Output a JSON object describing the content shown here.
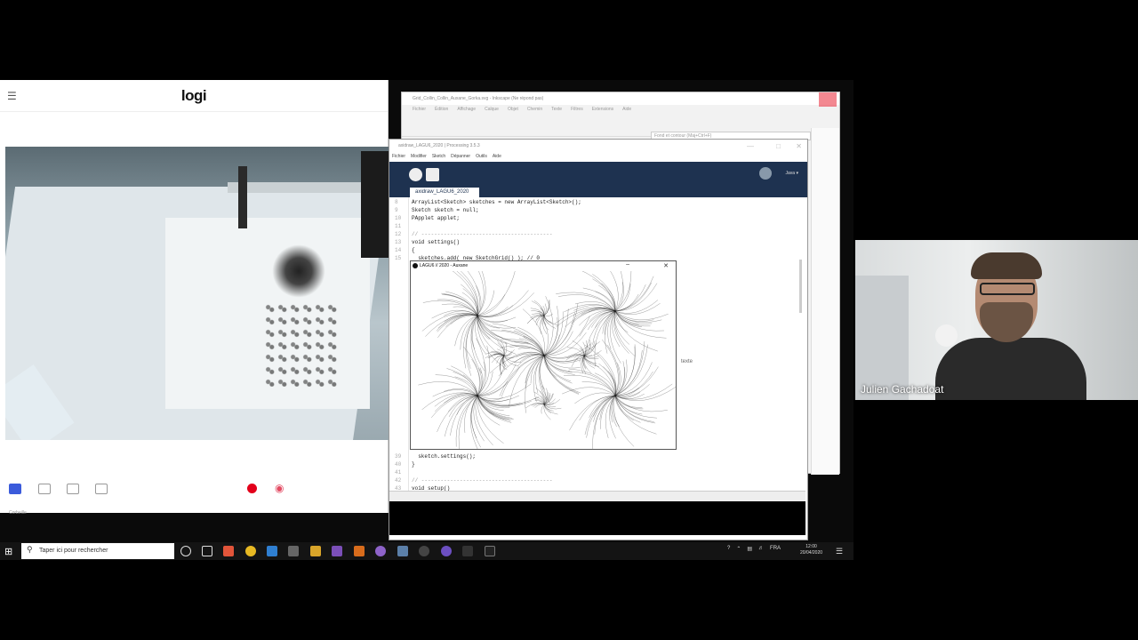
{
  "logi": {
    "brand": "logi",
    "footer_text": "Corbeille"
  },
  "inkscape": {
    "title": "Grid_Collin_Collin_Auxane_Gorka.svg - Inkscape (Ne répond pas)",
    "menu": [
      "Fichier",
      "Édition",
      "Affichage",
      "Calque",
      "Objet",
      "Chemin",
      "Texte",
      "Filtres",
      "Extensions",
      "Aide"
    ],
    "hint": "Fond et contour (Maj+Ctrl+F)"
  },
  "processing": {
    "title": "axidraw_LAGU6_2020 | Processing 3.5.3",
    "menu": [
      "Fichier",
      "Modifier",
      "Sketch",
      "Dépanner",
      "Outils",
      "Aide"
    ],
    "mode": "Java ▾",
    "tab": "axidraw_LAGU6_2020",
    "code": [
      {
        "n": "8",
        "t": "ArrayList<Sketch> sketches = new ArrayList<Sketch>();"
      },
      {
        "n": "9",
        "t": "Sketch sketch = null;"
      },
      {
        "n": "10",
        "t": "PApplet applet;"
      },
      {
        "n": "11",
        "t": ""
      },
      {
        "n": "12",
        "t": "// -----------------------------------------"
      },
      {
        "n": "13",
        "t": "void settings()"
      },
      {
        "n": "14",
        "t": "{"
      },
      {
        "n": "15",
        "t": "  sketches.add( new SketchGrid() ); // 0"
      },
      {
        "n": "39",
        "t": "  sketch.settings();"
      },
      {
        "n": "40",
        "t": "}"
      },
      {
        "n": "41",
        "t": ""
      },
      {
        "n": "42",
        "t": "// -----------------------------------------"
      },
      {
        "n": "43",
        "t": "void setup()"
      }
    ],
    "side_text": "texte"
  },
  "sketch_window": {
    "title": "LAGU6 // 2020 - Auxane"
  },
  "webcam": {
    "name": "Julien Gachadoat"
  },
  "taskbar": {
    "start_icon": "windows-icon",
    "search_placeholder": "Taper ici pour rechercher",
    "lang": "FRA",
    "time": "12:00",
    "date": "20/04/2020"
  },
  "colors": {
    "processing_toolbar": "#1e3250",
    "record": "#e3001b",
    "taskbar": "#141414"
  }
}
